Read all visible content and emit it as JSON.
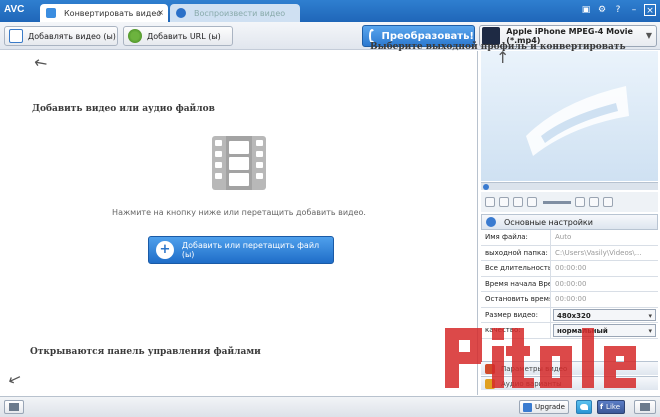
{
  "titlebar": {
    "logo": "AVC",
    "tabs": [
      {
        "label": "Конвертировать видео",
        "active": true
      },
      {
        "label": "Воспроизвести видео",
        "active": false
      }
    ],
    "tab_close": "×",
    "window_buttons": [
      "▣",
      "⚙",
      "?",
      "–",
      "×"
    ]
  },
  "toolbar": {
    "add_video_label": "Добавлять видео (ы)",
    "add_url_label": "Добавить URL (ы)",
    "convert_label": "Преобразовать!",
    "profile_label": "Apple iPhone MPEG-4 Movie (*.mp4)"
  },
  "main": {
    "hint_add": "Добавить видео или аудио файлов",
    "hint_profile": "Выберите выходной профиль и конвертировать",
    "hint_files": "Открываются панель управления файлами",
    "drop_text": "Нажмите на кнопку ниже или перетащить добавить видео.",
    "add_file_button": "Добавить или перетащить файл (ы)"
  },
  "settings": {
    "header": "Основные настройки",
    "rows": [
      {
        "key": "Имя файла:",
        "value": "Auto"
      },
      {
        "key": "выходной папка:",
        "value": "C:\\Users\\Vasily\\Videos\\..."
      },
      {
        "key": "Все длительность кл",
        "value": "00:00:00"
      },
      {
        "key": "Время начала Врем",
        "value": "00:00:00"
      },
      {
        "key": "Остановить время:",
        "value": "00:00:00"
      }
    ],
    "video_size_label": "Размер видео:",
    "video_size_value": "480x320",
    "quality_label": "качество:",
    "quality_value": "нормальный"
  },
  "accordion": {
    "video_options": "Параметры видео",
    "audio_options": "Аудио варианты"
  },
  "statusbar": {
    "upgrade_label": "Upgrade",
    "like_label": "Like",
    "facebook_letter": "f"
  },
  "colors": {
    "titlebar": "#2f7fd0",
    "accent": "#2c79d0",
    "watermark": "#d62a2a"
  },
  "icons": {
    "add_video": "add-video-icon",
    "add_url": "globe-plus-icon",
    "convert": "refresh-icon",
    "profile": "phone-icon",
    "film": "film-strip-icon"
  }
}
